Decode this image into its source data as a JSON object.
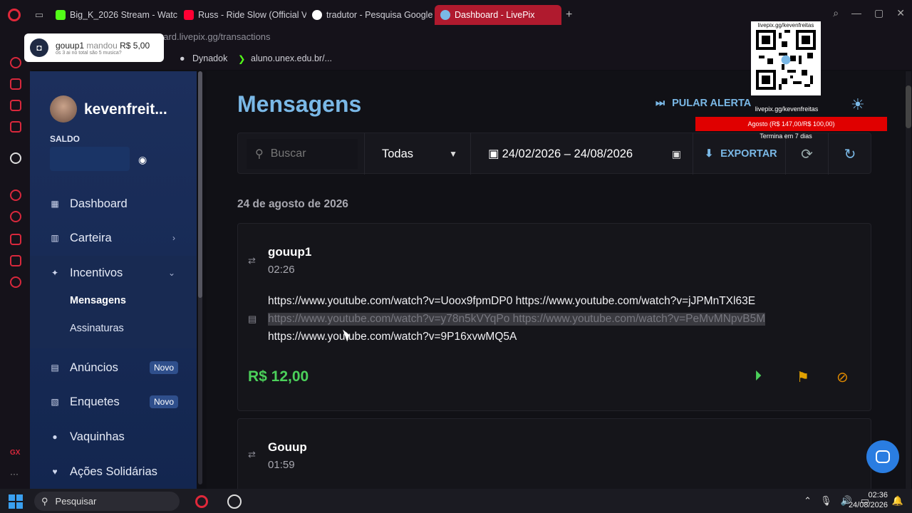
{
  "browser": {
    "tabs": [
      {
        "label": "Big_K_2026 Stream - Watc",
        "icon": "kick-icon",
        "color": "#53fc18"
      },
      {
        "label": "Russ - Ride Slow (Official V",
        "icon": "youtube-icon",
        "color": "#ff0033"
      },
      {
        "label": "tradutor - Pesquisa Google",
        "icon": "google-icon",
        "color": "#4285f4"
      },
      {
        "label": "Dashboard - LivePix",
        "icon": "livepix-icon",
        "color": "#7ab8e6"
      }
    ],
    "url": "oard.livepix.gg/transactions",
    "bookmarks": [
      "...",
      "Dynadok",
      "aluno.unex.edu.br/..."
    ]
  },
  "notification": {
    "user": "gouup1",
    "verb": "mandou",
    "amount": "R$ 5,00",
    "subtext": "os 3 ai no total são 5 musica?"
  },
  "overlay": {
    "qr_label": "livepix.gg/kevenfreitas",
    "qr_url": "livepix.gg/kevenfreitas",
    "goal": "Agosto (R$ 147,00/R$ 100,00)",
    "goal_sub": "Termina em 7 dias"
  },
  "sidebar": {
    "username": "kevenfreit...",
    "saldo_label": "SALDO",
    "items": [
      {
        "label": "Dashboard",
        "icon": "dashboard-icon"
      },
      {
        "label": "Carteira",
        "icon": "bank-icon"
      },
      {
        "label": "Incentivos",
        "icon": "sparkle-icon"
      },
      {
        "label": "Anúncios",
        "icon": "ads-icon",
        "badge": "Novo"
      },
      {
        "label": "Enquetes",
        "icon": "poll-icon",
        "badge": "Novo"
      },
      {
        "label": "Vaquinhas",
        "icon": "piggy-icon"
      },
      {
        "label": "Ações Solidárias",
        "icon": "hands-icon"
      }
    ],
    "subitems": [
      "Mensagens",
      "Assinaturas"
    ]
  },
  "main": {
    "title": "Mensagens",
    "pular_alerta": "PULAR ALERTA",
    "search_placeholder": "Buscar",
    "filter_value": "Todas",
    "date_range": "24/02/2026 – 24/08/2026",
    "export_label": "EXPORTAR",
    "date_header": "24 de agosto de 2026",
    "messages": [
      {
        "user": "gouup1",
        "time": "02:26",
        "lines": [
          "https://www.youtube.com/watch?v=Uoox9fpmDP0 https://www.youtube.com/watch?v=jJPMnTXl63E",
          "https://www.youtube.com/watch?v=y78n5kVYqPo https://www.youtube.com/watch?v=PeMvMNpvB5M",
          "https://www.youtube.com/watch?v=9P16xvwMQ5A"
        ],
        "amount": "R$ 12,00"
      },
      {
        "user": "Gouup",
        "time": "01:59"
      }
    ]
  },
  "taskbar": {
    "search_label": "Pesquisar",
    "time": "02:36",
    "date": "24/08/2026"
  },
  "colors": {
    "accent": "#7ab8e6",
    "amount": "#4bd05a",
    "flag": "#e0a000",
    "danger": "#e08a00"
  }
}
